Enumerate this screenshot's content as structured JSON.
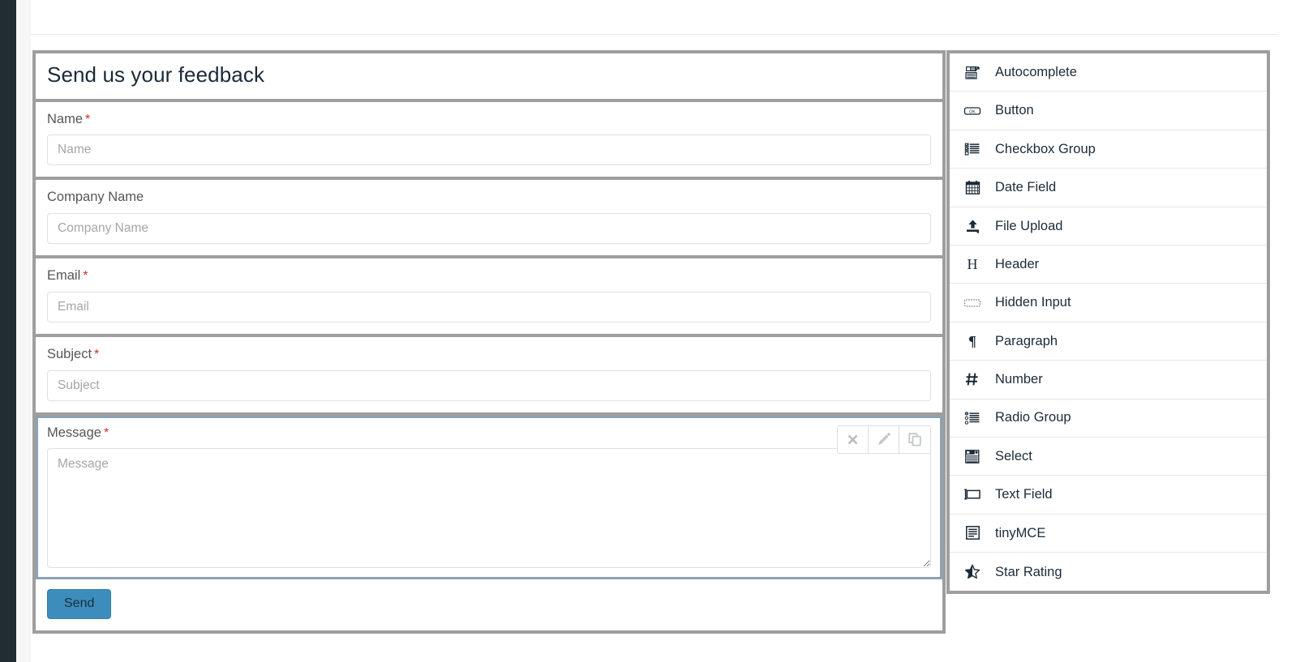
{
  "form": {
    "title": "Send us your feedback",
    "fields": [
      {
        "label": "Name",
        "required": true,
        "placeholder": "Name",
        "type": "text",
        "selected": false
      },
      {
        "label": "Company Name",
        "required": false,
        "placeholder": "Company Name",
        "type": "text",
        "selected": false
      },
      {
        "label": "Email",
        "required": true,
        "placeholder": "Email",
        "type": "text",
        "selected": false
      },
      {
        "label": "Subject",
        "required": true,
        "placeholder": "Subject",
        "type": "text",
        "selected": false
      },
      {
        "label": "Message",
        "required": true,
        "placeholder": "Message",
        "type": "textarea",
        "selected": true
      }
    ],
    "required_marker": "*",
    "submit_label": "Send",
    "submit_color": "#3c8dbc",
    "required_color": "#c9302c",
    "title_color": "#1b2a38",
    "label_color": "#555555",
    "panel_border_color": "#9e9e9e",
    "selected_border_color": "#8ba2b4"
  },
  "field_toolbar": {
    "buttons": [
      {
        "name": "remove",
        "icon": "close-icon"
      },
      {
        "name": "edit",
        "icon": "pencil-icon"
      },
      {
        "name": "copy",
        "icon": "copy-icon"
      }
    ]
  },
  "palette": {
    "items": [
      {
        "label": "Autocomplete",
        "icon": "autocomplete-icon"
      },
      {
        "label": "Button",
        "icon": "button-icon"
      },
      {
        "label": "Checkbox Group",
        "icon": "checkbox-list-icon"
      },
      {
        "label": "Date Field",
        "icon": "calendar-icon"
      },
      {
        "label": "File Upload",
        "icon": "upload-icon"
      },
      {
        "label": "Header",
        "icon": "heading-h-icon"
      },
      {
        "label": "Hidden Input",
        "icon": "hidden-input-icon"
      },
      {
        "label": "Paragraph",
        "icon": "pilcrow-icon"
      },
      {
        "label": "Number",
        "icon": "hash-icon"
      },
      {
        "label": "Radio Group",
        "icon": "radio-list-icon"
      },
      {
        "label": "Select",
        "icon": "select-dropdown-icon"
      },
      {
        "label": "Text Field",
        "icon": "text-field-icon"
      },
      {
        "label": "tinyMCE",
        "icon": "rich-text-icon"
      },
      {
        "label": "Star Rating",
        "icon": "half-star-icon"
      }
    ]
  },
  "theme": {
    "nav_strip_color": "#222d32",
    "page_background": "#ffffff",
    "gutter_color": "#f6f6f6"
  }
}
